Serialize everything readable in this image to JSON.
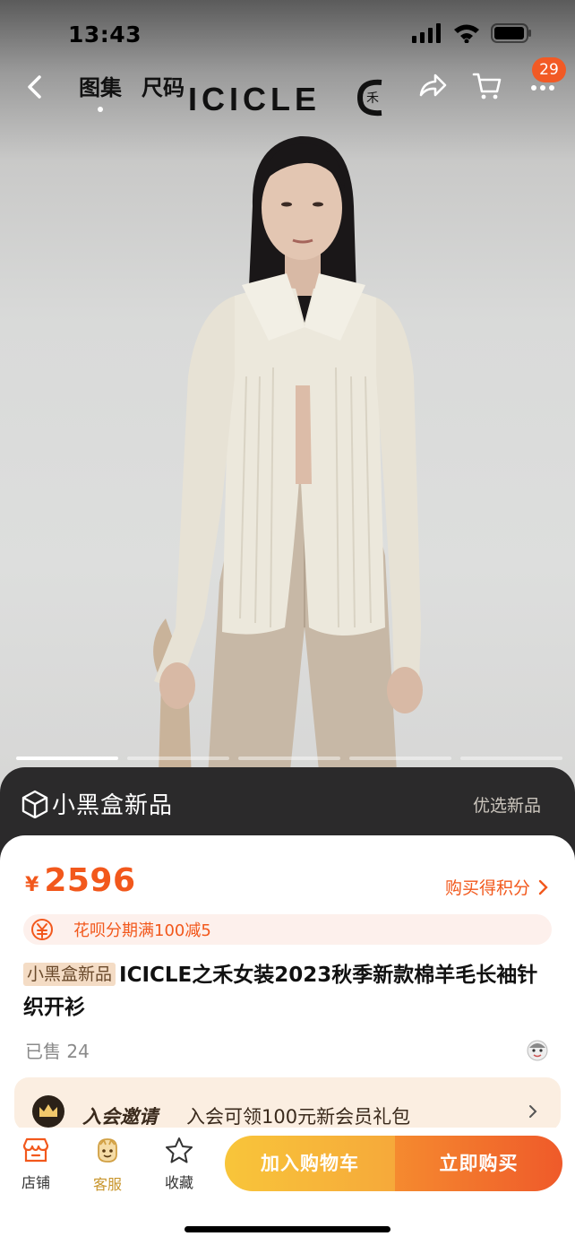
{
  "status_bar": {
    "time": "13:43"
  },
  "nav": {
    "tabs": [
      {
        "label": "图集",
        "active": true
      },
      {
        "label": "尺码",
        "active": false
      }
    ],
    "brand": "ICICLE",
    "cart_badge": "29"
  },
  "carousel": {
    "count": 5,
    "active_index": 0
  },
  "blackbox": {
    "title": "小黑盒新品",
    "right_label": "优选新品"
  },
  "product": {
    "currency": "¥",
    "price": "2596",
    "points_link": "购买得积分",
    "promo": "花呗分期满100减5",
    "title_tag": "小黑盒新品",
    "title": "ICICLE之禾女装2023秋季新款棉羊毛长袖针织开衫",
    "sold": "已售 24"
  },
  "member": {
    "strong": "入会邀请",
    "text": "入会可领100元新会员礼包"
  },
  "bottom_bar": {
    "shop": "店铺",
    "service": "客服",
    "favorite": "收藏",
    "add_to_cart": "加入购物车",
    "buy_now": "立即购买"
  },
  "colors": {
    "accent": "#f2581c",
    "cart_button": "#f8c53a",
    "buy_button": "#ef5a2a",
    "banner": "#2b2a2b"
  }
}
